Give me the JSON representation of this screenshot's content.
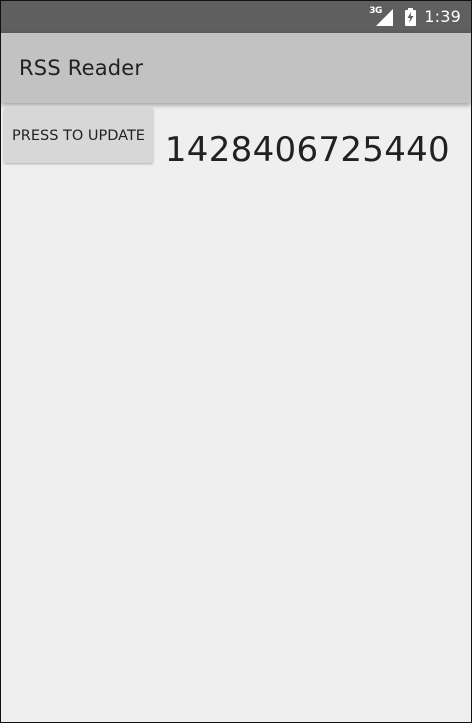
{
  "status_bar": {
    "network_label": "3G",
    "time": "1:39",
    "signal_icon": "signal-icon",
    "battery_icon": "battery-charging-icon"
  },
  "app_bar": {
    "title": "RSS Reader"
  },
  "content": {
    "update_button_label": "PRESS TO UPDATE",
    "timestamp_value": "1428406725440"
  },
  "colors": {
    "status_bar": "#5f5f5f",
    "app_bar": "#c2c2c2",
    "background": "#efefef",
    "button": "#d7d7d7",
    "text": "#212121"
  }
}
